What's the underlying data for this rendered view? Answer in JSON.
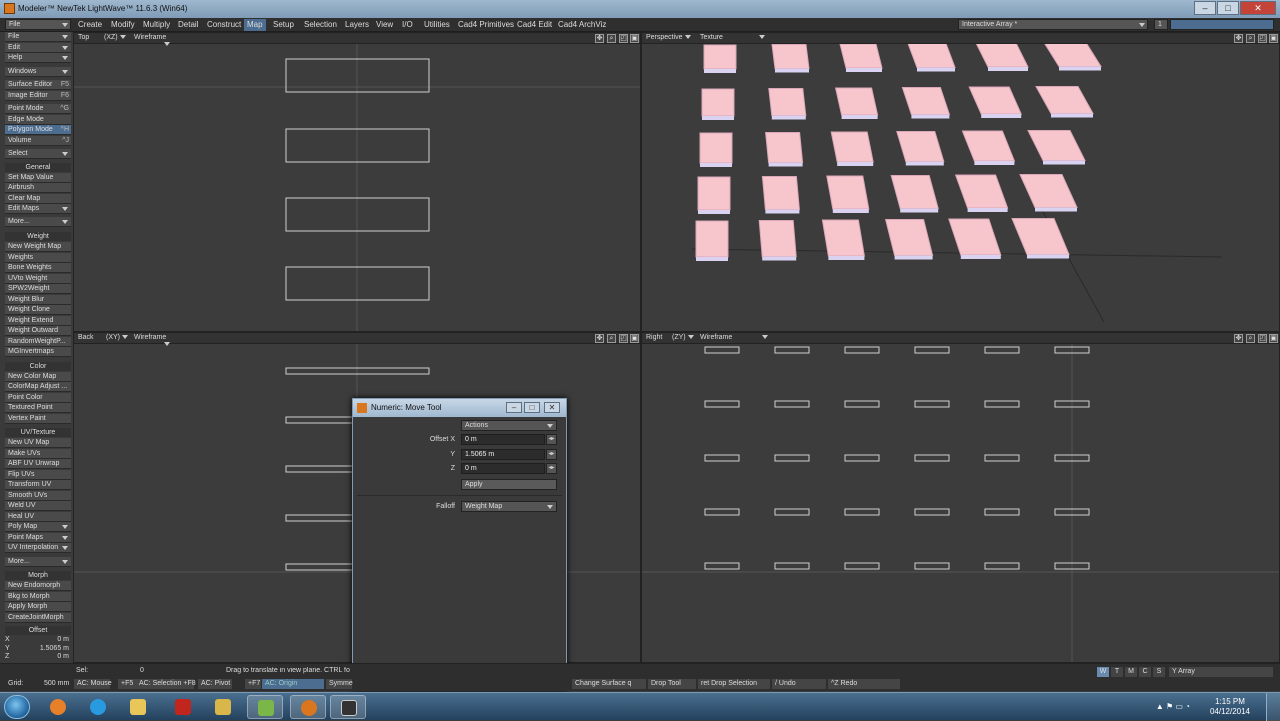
{
  "window": {
    "title": "Modeler™ NewTek LightWave™ 11.6.3 (Win64)"
  },
  "menubar": {
    "tabs": [
      "Create",
      "Modify",
      "Multiply",
      "Detail",
      "Construct",
      "Map",
      "Setup",
      "Selection",
      "Layers",
      "View",
      "I/O",
      "Utilities",
      "Cad4 Primitives",
      "Cad4 Edit",
      "Cad4 ArchViz"
    ],
    "active_tab": "Map",
    "preset": "Interactive Array *"
  },
  "sidebar": {
    "top": [
      {
        "label": "File",
        "dropdown": true
      },
      {
        "label": "Edit",
        "dropdown": true
      },
      {
        "label": "Help",
        "dropdown": true
      },
      {
        "label": "Windows",
        "dropdown": true
      },
      {
        "label": "Surface Editor",
        "shortcut": "F5"
      },
      {
        "label": "Image Editor",
        "shortcut": "F6"
      },
      {
        "label": "Point Mode",
        "shortcut": "^G"
      },
      {
        "label": "Edge Mode",
        "shortcut": ""
      },
      {
        "label": "Polygon Mode",
        "shortcut": "^H",
        "active": true
      },
      {
        "label": "Volume",
        "shortcut": "^J"
      },
      {
        "label": "Select",
        "dropdown": true
      }
    ],
    "general_header": "General",
    "general": [
      "Set Map Value",
      "Airbrush",
      "Clear Map",
      "Edit Maps",
      "More..."
    ],
    "weight_header": "Weight",
    "weight": [
      "New Weight Map",
      "Weights",
      "Bone Weights",
      "UVto Weight",
      "SPW2Weight",
      "Weight Blur",
      "Weight Clone",
      "Weight Extend",
      "Weight Outward",
      "RandomWeightP...",
      "MGInvertmaps"
    ],
    "color_header": "Color",
    "color": [
      "New Color Map",
      "ColorMap Adjust ...",
      "Point Color",
      "Textured Point",
      "Vertex Paint"
    ],
    "uv_header": "UV/Texture",
    "uv": [
      "New UV Map",
      "Make UVs",
      "ABF UV Unwrap",
      "Flip UVs",
      "Transform UV",
      "Smooth UVs",
      "Weld UV",
      "Heal UV",
      "Poly Map",
      "Point Maps",
      "UV Interpolation",
      "More..."
    ],
    "morph_header": "Morph",
    "morph": [
      "New Endomorph",
      "Bkg to Morph",
      "Apply Morph",
      "CreateJointMorph"
    ],
    "offset_header": "Offset",
    "offset": [
      {
        "axis": "X",
        "value": "0 m"
      },
      {
        "axis": "Y",
        "value": "1.5065 m"
      },
      {
        "axis": "Z",
        "value": "0 m"
      }
    ]
  },
  "viewports": {
    "top": {
      "view": "Top",
      "axis": "(XZ)",
      "mode": "Wireframe"
    },
    "perspective": {
      "view": "Perspective",
      "mode": "Texture"
    },
    "back": {
      "view": "Back",
      "axis": "(XY)",
      "mode": "Wireframe"
    },
    "right": {
      "view": "Right",
      "axis": "(ZY)",
      "mode": "Wireframe"
    }
  },
  "dialog": {
    "title": "Numeric: Move Tool",
    "actions_label": "Actions",
    "offset_x_label": "Offset X",
    "offset_x": "0 m",
    "y_label": "Y",
    "y": "1.5065 m",
    "z_label": "Z",
    "z": "0 m",
    "apply": "Apply",
    "falloff_label": "Falloff",
    "falloff": "Weight Map"
  },
  "statusbar": {
    "sel_label": "Sel:",
    "sel_value": "0",
    "hint": "Drag to translate in view plane. CTRL fo",
    "grid_label": "Grid:",
    "grid_value": "500 mm",
    "buttons": [
      {
        "label": "AC: Mouse"
      },
      {
        "label": "+F5"
      },
      {
        "label": "AC: Selection +F8"
      },
      {
        "label": "AC: Pivot"
      },
      {
        "label": "+F7"
      },
      {
        "label": "AC: Origin",
        "active": true
      },
      {
        "label": "Symme"
      }
    ],
    "right_buttons": [
      "Change Surface q",
      "Drop Tool",
      "ret Drop Selection",
      "/ Undo",
      "^Z Redo"
    ],
    "wtmcs": [
      "W",
      "T",
      "M",
      "C",
      "S"
    ],
    "array_mode": "Y Array"
  },
  "taskbar": {
    "time": "1:15 PM",
    "date": "04/12/2014"
  }
}
